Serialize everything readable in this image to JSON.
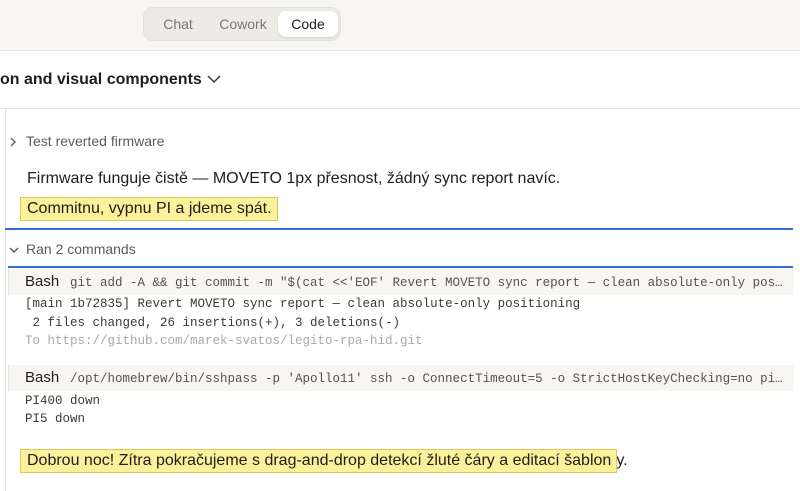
{
  "mode_switcher": {
    "tabs": [
      "Chat",
      "Cowork",
      "Code"
    ],
    "active": "Code"
  },
  "header": {
    "title": "on and visual components"
  },
  "sections": {
    "test_reverted": "Test reverted firmware",
    "ran_commands": "Ran 2 commands"
  },
  "messages": {
    "firmware_status": "Firmware funguje čistě — MOVETO 1px přesnost, žádný sync report navíc.",
    "commit_note": "Commitnu, vypnu PI a jdeme spát.",
    "good_night": "Dobrou noc! Zítra pokračujeme s drag-and-drop detekcí žluté čáry a editací šablon",
    "good_night_end": "y."
  },
  "commands": [
    {
      "label": "Bash",
      "command": "git add -A && git commit -m \"$(cat <<'EOF' Revert MOVETO sync report — clean absolute-only posit…",
      "output": [
        "[main 1b72835] Revert MOVETO sync report — clean absolute-only positioning",
        " 2 files changed, 26 insertions(+), 3 deletions(-)",
        "To https://github.com/marek-svatos/legito-rpa-hid.git"
      ]
    },
    {
      "label": "Bash",
      "command": "/opt/homebrew/bin/sshpass -p 'Apollo11' ssh -o ConnectTimeout=5 -o StrictHostKeyChecking=no pi@p…",
      "output": [
        "PI400 down",
        "PI5 down"
      ]
    }
  ],
  "colors": {
    "highlight": "#fbf19a",
    "annotation_line": "#2f6fd1"
  }
}
